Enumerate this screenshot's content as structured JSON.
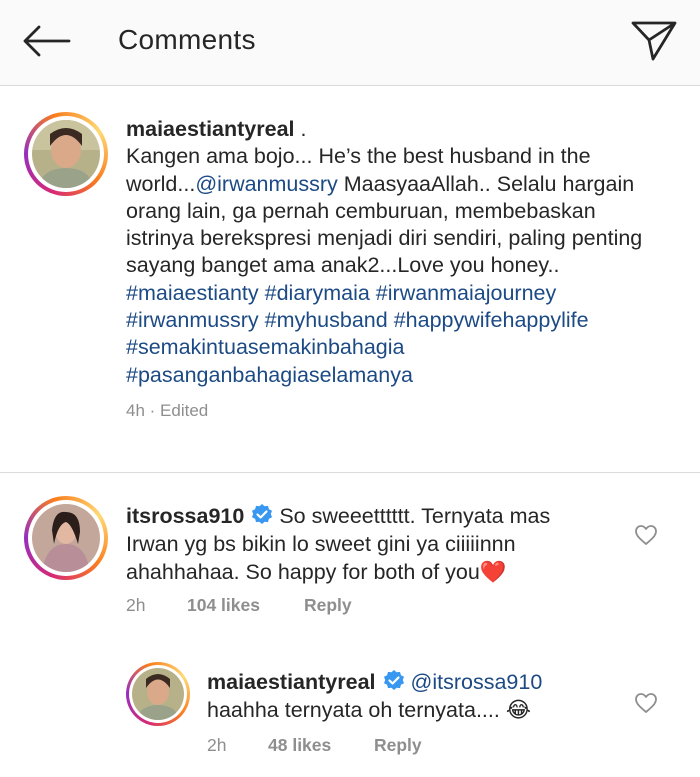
{
  "header": {
    "title": "Comments",
    "back_icon": "back-arrow-icon",
    "share_icon": "direct-send-icon"
  },
  "post": {
    "username": "maiaestiantyreal",
    "username_suffix": " .",
    "text_1": "Kangen ama bojo... He’s the best husband in the world...",
    "mention": "@irwanmussry",
    "text_2": " MaasyaaAllah.. Selalu hargain orang lain, ga pernah cemburuan, membebaskan istrinya berekspresi menjadi diri sendiri, paling penting sayang banget ama anak2...Love you honey..",
    "hashtags": [
      "#maiaestianty",
      "#diarymaia",
      "#irwanmaiajourney",
      "#irwanmussry",
      "#myhusband",
      "#happywifehappylife",
      "#semakintuasemakinbahagia",
      "#pasanganbahagiaselamanya"
    ],
    "time": "4h",
    "separator": " · ",
    "edited": "Edited"
  },
  "comments": [
    {
      "username": "itsrossa910",
      "verified": true,
      "text": "So sweeetttttt. Ternyata mas Irwan yg bs bikin lo sweet gini ya ciiiiinnn ahahhahaa. So happy for both of you",
      "emoji": "❤️",
      "time": "2h",
      "likes": "104 likes",
      "reply_label": "Reply"
    },
    {
      "username": "maiaestiantyreal",
      "verified": true,
      "mention": "@itsrossa910",
      "text": "haahha ternyata oh ternyata....",
      "emoji": "😂",
      "time": "2h",
      "likes": "48 likes",
      "reply_label": "Reply"
    }
  ],
  "colors": {
    "link": "#1c4a85",
    "meta": "#8e8e8e",
    "verified": "#3897f0",
    "heart_emoji": "#e0245e"
  }
}
